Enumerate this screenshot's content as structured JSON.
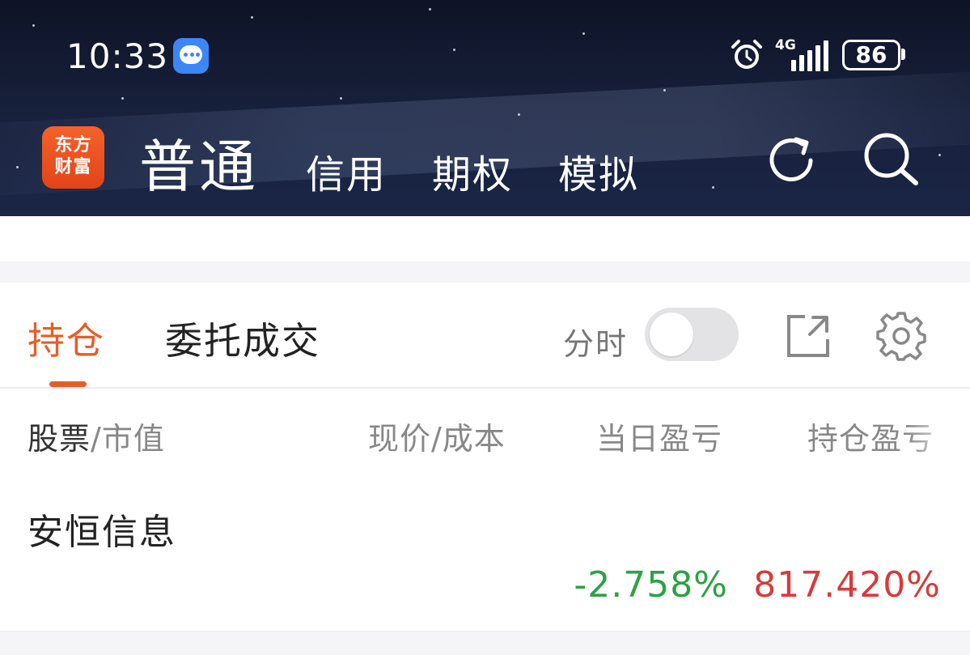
{
  "status_bar": {
    "time": "10:33",
    "network": "4G",
    "battery": "86"
  },
  "header": {
    "logo_line1": "东方",
    "logo_line2": "财富",
    "tabs": [
      {
        "label": "普通",
        "active": true
      },
      {
        "label": "信用",
        "active": false
      },
      {
        "label": "期权",
        "active": false
      },
      {
        "label": "模拟",
        "active": false
      }
    ]
  },
  "holdings": {
    "tabs": [
      {
        "label": "持仓",
        "active": true
      },
      {
        "label": "委托成交",
        "active": false
      }
    ],
    "fenshi_label": "分时",
    "fenshi_enabled": false,
    "columns": {
      "stock": "股票",
      "stock_sub": "/市值",
      "price": "现价/成本",
      "day_pl": "当日盈亏",
      "hold_pl": "持仓盈亏"
    },
    "rows": [
      {
        "name": "安恒信息",
        "day_pl_pct": "-2.758%",
        "hold_pl_pct": "817.420%"
      }
    ]
  },
  "colors": {
    "accent": "#e85d27",
    "loss": "#2ba245",
    "gain": "#d93a3a",
    "header_bg": "#141b33"
  }
}
